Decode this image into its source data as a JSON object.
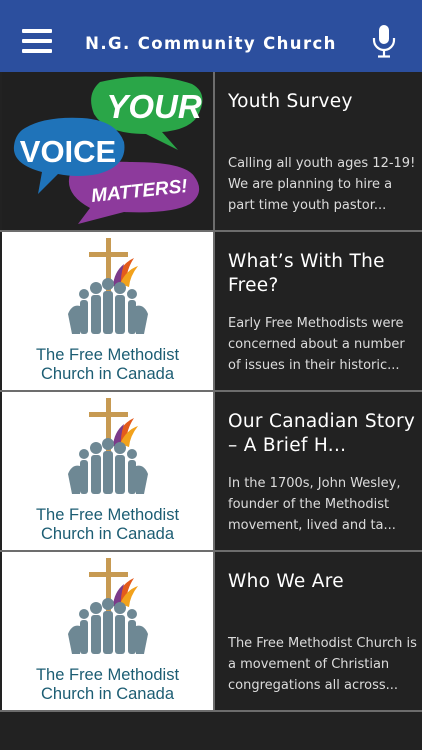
{
  "header": {
    "title": "N.G. Community Church",
    "menu_icon": "hamburger-menu-icon",
    "mic_icon": "microphone-icon",
    "background": "#2c4f9e"
  },
  "list": {
    "items": [
      {
        "title": "Youth Survey",
        "description": "Calling all youth ages 12-19! We are planning to hire a part time youth pastor...",
        "image": {
          "bubble1": "YOUR",
          "bubble2": "VOICE",
          "bubble3": "MATTERS!"
        }
      },
      {
        "title": "What’s With The Free?",
        "description": "Early Free Methodists were concerned about a number of issues in their historic...",
        "image": {
          "line1": "The Free Methodist",
          "line2": "Church in Canada"
        }
      },
      {
        "title": "Our Canadian Story – A Brief H...",
        "description": "In the 1700s, John Wesley, founder of the Methodist movement, lived and ta...",
        "image": {
          "line1": "The Free Methodist",
          "line2": "Church in Canada"
        }
      },
      {
        "title": "Who We Are",
        "description": "The Free Methodist Church is a movement of Christian congregations all across...",
        "image": {
          "line1": "The Free Methodist",
          "line2": "Church in Canada"
        }
      }
    ]
  },
  "colors": {
    "row_background": "#222222",
    "divider": "#6d6d6d",
    "logo_text": "#1c5d73",
    "bubble_green": "#2aa648",
    "bubble_blue": "#1f73b9",
    "bubble_purple": "#8d3a9c"
  }
}
